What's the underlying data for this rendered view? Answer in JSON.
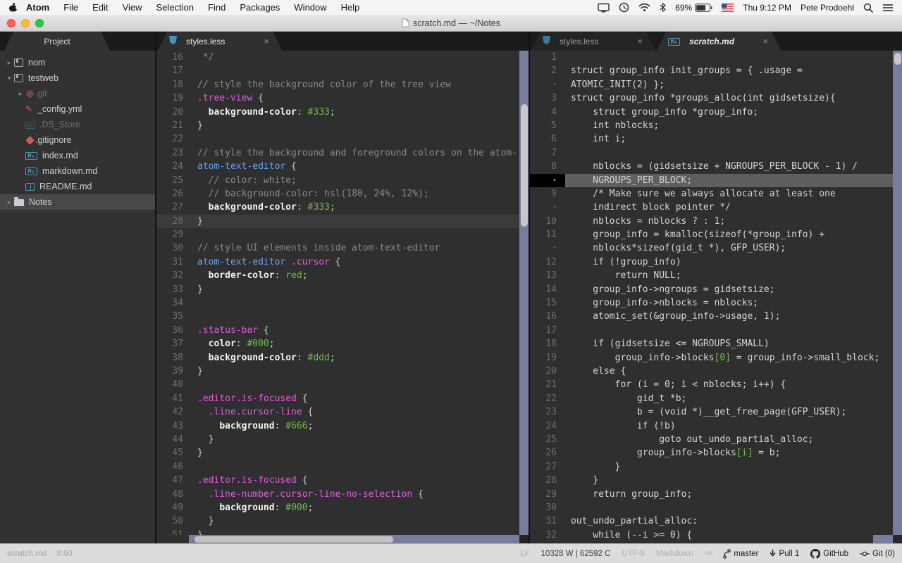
{
  "menubar": {
    "items": [
      "Atom",
      "File",
      "Edit",
      "View",
      "Selection",
      "Find",
      "Packages",
      "Window",
      "Help"
    ],
    "battery": "69%",
    "time": "Thu 9:12 PM",
    "user": "Pete Prodoehl"
  },
  "titlebar": {
    "title": "scratch.md — ~/Notes"
  },
  "ui": {
    "close_glyph": "×"
  },
  "tree": {
    "header": "Project",
    "items": [
      {
        "label": "nom",
        "icon": "repo",
        "chevron": "right",
        "depth": 0
      },
      {
        "label": "testweb",
        "icon": "repo",
        "chevron": "down",
        "depth": 0
      },
      {
        "label": ".git",
        "icon": "git",
        "chevron": "right",
        "depth": 1,
        "dim": true
      },
      {
        "label": "_config.yml",
        "icon": "config",
        "chevron": "",
        "depth": 1
      },
      {
        "label": ".DS_Store",
        "icon": "binary",
        "chevron": "",
        "depth": 1,
        "dim": true
      },
      {
        "label": ".gitignore",
        "icon": "git",
        "chevron": "",
        "depth": 1
      },
      {
        "label": "index.md",
        "icon": "markdown",
        "chevron": "",
        "depth": 1
      },
      {
        "label": "markdown.md",
        "icon": "markdown",
        "chevron": "",
        "depth": 1
      },
      {
        "label": "README.md",
        "icon": "book",
        "chevron": "",
        "depth": 1
      },
      {
        "label": "Notes",
        "icon": "folder",
        "chevron": "right",
        "depth": 0,
        "selected": true
      }
    ]
  },
  "middle_pane": {
    "tabs": [
      {
        "label": "styles.less",
        "icon": "less-icon",
        "active": true
      }
    ],
    "rows": [
      {
        "n": "16",
        "s": [
          [
            " */",
            "c"
          ]
        ]
      },
      {
        "n": "17",
        "s": []
      },
      {
        "n": "18",
        "s": [
          [
            "// style the background color of the tree view",
            "c"
          ]
        ]
      },
      {
        "n": "19",
        "s": [
          [
            ".tree-view",
            "sc"
          ],
          [
            " {",
            "pu"
          ]
        ]
      },
      {
        "n": "20",
        "s": [
          [
            "  ",
            "pl"
          ],
          [
            "background-color",
            "p"
          ],
          [
            ": ",
            "pu"
          ],
          [
            "#333",
            "v"
          ],
          [
            ";",
            "pu"
          ]
        ]
      },
      {
        "n": "21",
        "s": [
          [
            "}",
            "pu"
          ]
        ]
      },
      {
        "n": "22",
        "s": []
      },
      {
        "n": "23",
        "s": [
          [
            "// style the background and foreground colors on the atom-",
            "c"
          ]
        ]
      },
      {
        "n": "24",
        "s": [
          [
            "atom-text-editor",
            "st"
          ],
          [
            " {",
            "pu"
          ]
        ]
      },
      {
        "n": "25",
        "s": [
          [
            "  // color: white;",
            "c"
          ]
        ]
      },
      {
        "n": "26",
        "s": [
          [
            "  // background-color: hsl(180, 24%, 12%);",
            "c"
          ]
        ]
      },
      {
        "n": "27",
        "s": [
          [
            "  ",
            "pl"
          ],
          [
            "background-color",
            "p"
          ],
          [
            ": ",
            "pu"
          ],
          [
            "#333",
            "v"
          ],
          [
            ";",
            "pu"
          ]
        ]
      },
      {
        "n": "28",
        "s": [
          [
            "}",
            "pu"
          ]
        ],
        "cur": true
      },
      {
        "n": "29",
        "s": []
      },
      {
        "n": "30",
        "s": [
          [
            "// style UI elements inside atom-text-editor",
            "c"
          ]
        ]
      },
      {
        "n": "31",
        "s": [
          [
            "atom-text-editor",
            "st"
          ],
          [
            " ",
            "pl"
          ],
          [
            ".cursor",
            "sc"
          ],
          [
            " {",
            "pu"
          ]
        ]
      },
      {
        "n": "32",
        "s": [
          [
            "  ",
            "pl"
          ],
          [
            "border-color",
            "p"
          ],
          [
            ": ",
            "pu"
          ],
          [
            "red",
            "v"
          ],
          [
            ";",
            "pu"
          ]
        ]
      },
      {
        "n": "33",
        "s": [
          [
            "}",
            "pu"
          ]
        ]
      },
      {
        "n": "34",
        "s": []
      },
      {
        "n": "35",
        "s": []
      },
      {
        "n": "36",
        "s": [
          [
            ".status-bar",
            "sc"
          ],
          [
            " {",
            "pu"
          ]
        ]
      },
      {
        "n": "37",
        "s": [
          [
            "  ",
            "pl"
          ],
          [
            "color",
            "p"
          ],
          [
            ": ",
            "pu"
          ],
          [
            "#000",
            "v"
          ],
          [
            ";",
            "pu"
          ]
        ]
      },
      {
        "n": "38",
        "s": [
          [
            "  ",
            "pl"
          ],
          [
            "background-color",
            "p"
          ],
          [
            ": ",
            "pu"
          ],
          [
            "#ddd",
            "v"
          ],
          [
            ";",
            "pu"
          ]
        ]
      },
      {
        "n": "39",
        "s": [
          [
            "}",
            "pu"
          ]
        ]
      },
      {
        "n": "40",
        "s": []
      },
      {
        "n": "41",
        "s": [
          [
            ".editor.is-focused",
            "sc"
          ],
          [
            " {",
            "pu"
          ]
        ]
      },
      {
        "n": "42",
        "s": [
          [
            "  ",
            "pl"
          ],
          [
            ".line.cursor-line",
            "sc"
          ],
          [
            " {",
            "pu"
          ]
        ]
      },
      {
        "n": "43",
        "s": [
          [
            "    ",
            "pl"
          ],
          [
            "background",
            "p"
          ],
          [
            ": ",
            "pu"
          ],
          [
            "#666",
            "v"
          ],
          [
            ";",
            "pu"
          ]
        ]
      },
      {
        "n": "44",
        "s": [
          [
            "  }",
            "pu"
          ]
        ]
      },
      {
        "n": "45",
        "s": [
          [
            "}",
            "pu"
          ]
        ]
      },
      {
        "n": "46",
        "s": []
      },
      {
        "n": "47",
        "s": [
          [
            ".editor.is-focused",
            "sc"
          ],
          [
            " {",
            "pu"
          ]
        ]
      },
      {
        "n": "48",
        "s": [
          [
            "  ",
            "pl"
          ],
          [
            ".line-number.cursor-line-no-selection",
            "sc"
          ],
          [
            " {",
            "pu"
          ]
        ]
      },
      {
        "n": "49",
        "s": [
          [
            "    ",
            "pl"
          ],
          [
            "background",
            "p"
          ],
          [
            ": ",
            "pu"
          ],
          [
            "#000",
            "v"
          ],
          [
            ";",
            "pu"
          ]
        ]
      },
      {
        "n": "50",
        "s": [
          [
            "  }",
            "pu"
          ]
        ]
      },
      {
        "n": "51",
        "s": [
          [
            "}",
            "pu"
          ]
        ]
      }
    ]
  },
  "right_pane": {
    "tabs": [
      {
        "label": "styles.less",
        "icon": "less-icon",
        "active": false
      },
      {
        "label": "scratch.md",
        "icon": "markdown-icon",
        "active": true,
        "italic": true
      }
    ],
    "rows": [
      {
        "n": "1",
        "s": []
      },
      {
        "n": "2",
        "s": [
          [
            "struct group_info init_groups = { .usage =",
            "pl"
          ]
        ]
      },
      {
        "n": "•",
        "s": [
          [
            "ATOMIC_INIT(2) };",
            "pl"
          ]
        ]
      },
      {
        "n": "3",
        "s": [
          [
            "struct group_info *groups_alloc(int gidsetsize){",
            "pl"
          ]
        ]
      },
      {
        "n": "4",
        "s": [
          [
            "    struct group_info *group_info;",
            "pl"
          ]
        ]
      },
      {
        "n": "5",
        "s": [
          [
            "    int nblocks;",
            "pl"
          ]
        ]
      },
      {
        "n": "6",
        "s": [
          [
            "    int i;",
            "pl"
          ]
        ]
      },
      {
        "n": "7",
        "s": []
      },
      {
        "n": "8",
        "s": [
          [
            "    nblocks = (gidsetsize + NGROUPS_PER_BLOCK - 1) /",
            "pl"
          ]
        ]
      },
      {
        "n": "•",
        "s": [
          [
            "    NGROUPS_PER_BLOCK;",
            "pl"
          ]
        ],
        "cur": true
      },
      {
        "n": "9",
        "s": [
          [
            "    /* Make sure we always allocate at least one",
            "pl"
          ]
        ]
      },
      {
        "n": "•",
        "s": [
          [
            "    indirect block pointer */",
            "pl"
          ]
        ]
      },
      {
        "n": "10",
        "s": [
          [
            "    nblocks = nblocks ? : 1;",
            "pl"
          ]
        ]
      },
      {
        "n": "11",
        "s": [
          [
            "    group_info = kmalloc(sizeof(*group_info) +",
            "pl"
          ]
        ]
      },
      {
        "n": "•",
        "s": [
          [
            "    nblocks*sizeof(gid_t *), GFP_USER);",
            "pl"
          ]
        ]
      },
      {
        "n": "12",
        "s": [
          [
            "    if (!group_info)",
            "pl"
          ]
        ]
      },
      {
        "n": "13",
        "s": [
          [
            "        return NULL;",
            "pl"
          ]
        ]
      },
      {
        "n": "14",
        "s": [
          [
            "    group_info->ngroups = gidsetsize;",
            "pl"
          ]
        ]
      },
      {
        "n": "15",
        "s": [
          [
            "    group_info->nblocks = nblocks;",
            "pl"
          ]
        ]
      },
      {
        "n": "16",
        "s": [
          [
            "    atomic_set(&group_info->usage, 1);",
            "pl"
          ]
        ]
      },
      {
        "n": "17",
        "s": []
      },
      {
        "n": "18",
        "s": [
          [
            "    if (gidsetsize <= NGROUPS_SMALL)",
            "pl"
          ]
        ]
      },
      {
        "n": "19",
        "s": [
          [
            "        group_info->blocks",
            "pl"
          ],
          [
            "[0]",
            "v"
          ],
          [
            " = group_info->small_block;",
            "pl"
          ]
        ]
      },
      {
        "n": "20",
        "s": [
          [
            "    else {",
            "pl"
          ]
        ]
      },
      {
        "n": "21",
        "s": [
          [
            "        for (i = 0; i < nblocks; i++) {",
            "pl"
          ]
        ]
      },
      {
        "n": "22",
        "s": [
          [
            "            gid_t *b;",
            "pl"
          ]
        ]
      },
      {
        "n": "23",
        "s": [
          [
            "            b = (void *)__get_free_page(GFP_USER);",
            "pl"
          ]
        ]
      },
      {
        "n": "24",
        "s": [
          [
            "            if (!b)",
            "pl"
          ]
        ]
      },
      {
        "n": "25",
        "s": [
          [
            "                goto out_undo_partial_alloc;",
            "pl"
          ]
        ]
      },
      {
        "n": "26",
        "s": [
          [
            "            group_info->blocks",
            "pl"
          ],
          [
            "[i]",
            "v"
          ],
          [
            " = b;",
            "pl"
          ]
        ]
      },
      {
        "n": "27",
        "s": [
          [
            "        }",
            "pl"
          ]
        ]
      },
      {
        "n": "28",
        "s": [
          [
            "    }",
            "pl"
          ]
        ]
      },
      {
        "n": "29",
        "s": [
          [
            "    return group_info;",
            "pl"
          ]
        ]
      },
      {
        "n": "30",
        "s": []
      },
      {
        "n": "31",
        "s": [
          [
            "out_undo_partial_alloc:",
            "pl"
          ]
        ]
      },
      {
        "n": "32",
        "s": [
          [
            "    while (--i >= 0) {",
            "pl"
          ]
        ]
      }
    ]
  },
  "statusbar": {
    "file": "scratch.md",
    "position": "8:60",
    "line_ending": "LF",
    "counts": "10328 W | 62592 C",
    "encoding": "UTF-8",
    "grammar": "Markdown",
    "case_glyph": "aA",
    "branch": "master",
    "pull": "Pull 1",
    "github": "GitHub",
    "git": "Git (0)"
  }
}
